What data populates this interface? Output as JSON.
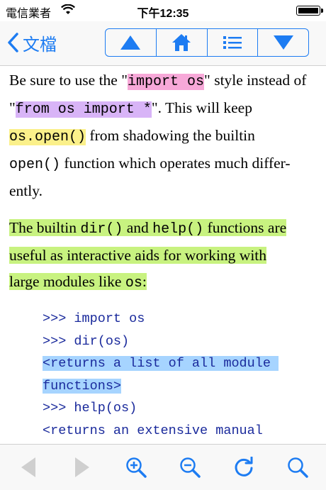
{
  "status": {
    "carrier": "電信業者",
    "time": "下午12:35"
  },
  "nav": {
    "back_label": "文檔"
  },
  "para1": {
    "t1": "Be sure to use the \"",
    "c1": "import os",
    "t2": "\" style instead of \"",
    "c2": "from os import *",
    "t3": "\". This will keep",
    "c3": "os.open()",
    "t4": " from shadowing the builtin",
    "c4": "open()",
    "t5": " function which operates much differ-",
    "t6": "ently."
  },
  "para2": {
    "t1": "The builtin ",
    "c1": "dir()",
    "t2": " and ",
    "c2": "help()",
    "t3": " functions are",
    "t4": "useful as interactive aids for working with",
    "t5": "large modules like ",
    "c3": "os",
    "t6": ":"
  },
  "code_lines": [
    ">>> import os",
    ">>> dir(os)",
    "<returns a list of all module ",
    "functions>",
    ">>> help(os)",
    "<returns an extensive manual"
  ]
}
